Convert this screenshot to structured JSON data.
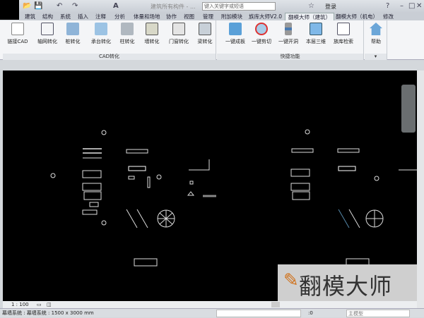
{
  "title_bar": {
    "doc_title": "建筑所有构件 - ...",
    "search_placeholder": "键入关键字或短语",
    "login": "登录"
  },
  "tabs": [
    "建筑",
    "结构",
    "系统",
    "插入",
    "注释",
    "分析",
    "体量和场地",
    "协作",
    "视图",
    "管理",
    "附加模块",
    "族库大师V2.0",
    "翻模大师（建筑）",
    "翻模大师（机电）",
    "修改"
  ],
  "active_tab": "翻模大师（建筑）",
  "panels": [
    {
      "label": "CAD转化",
      "buttons": [
        "链接CAD",
        "轴网转化",
        "桩转化",
        "承台转化",
        "柱转化",
        "墙转化",
        "门窗转化",
        "梁转化"
      ]
    },
    {
      "label": "快捷功能",
      "buttons": [
        "一键成板",
        "一键剪切",
        "一键开洞",
        "本层三维",
        "族库检索"
      ]
    },
    {
      "label": "",
      "buttons": [
        "帮助"
      ]
    }
  ],
  "view_bar": {
    "scale": "1 : 100"
  },
  "status": {
    "selection": "幕墙系统 : 幕墙系统 : 1500 x 3000 mm",
    "filter_count": ":0",
    "model": "主模型"
  },
  "watermark": {
    "text": "翻模大师"
  }
}
